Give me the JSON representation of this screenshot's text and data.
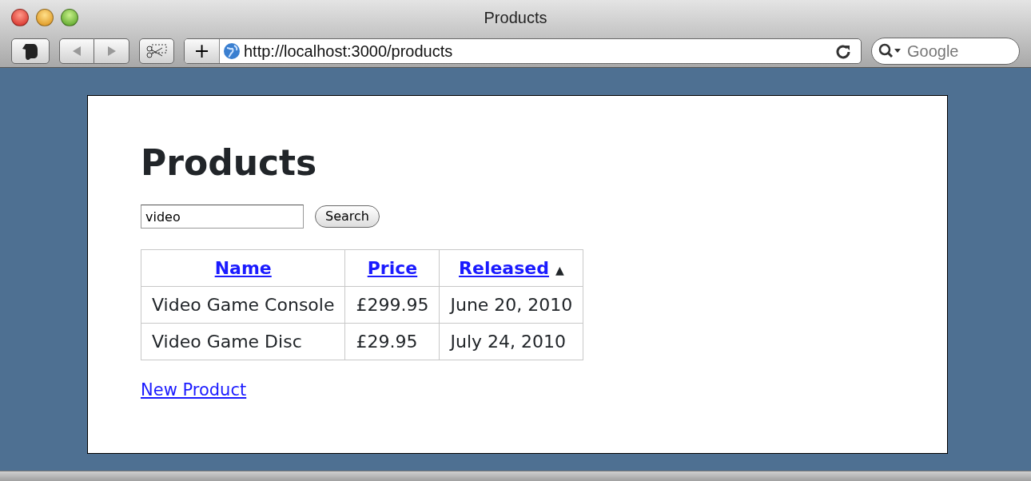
{
  "window": {
    "title": "Products"
  },
  "toolbar": {
    "address": "http://localhost:3000/products",
    "search_placeholder": "Google",
    "add_tab_label": "+"
  },
  "page": {
    "heading": "Products",
    "search": {
      "value": "video",
      "button": "Search"
    },
    "table": {
      "columns": [
        {
          "label": "Name"
        },
        {
          "label": "Price"
        },
        {
          "label": "Released",
          "sort_indicator": "▲"
        }
      ],
      "rows": [
        [
          "Video Game Console",
          "£299.95",
          "June 20, 2010"
        ],
        [
          "Video Game Disc",
          "£29.95",
          "July 24, 2010"
        ]
      ]
    },
    "new_link": "New Product"
  }
}
